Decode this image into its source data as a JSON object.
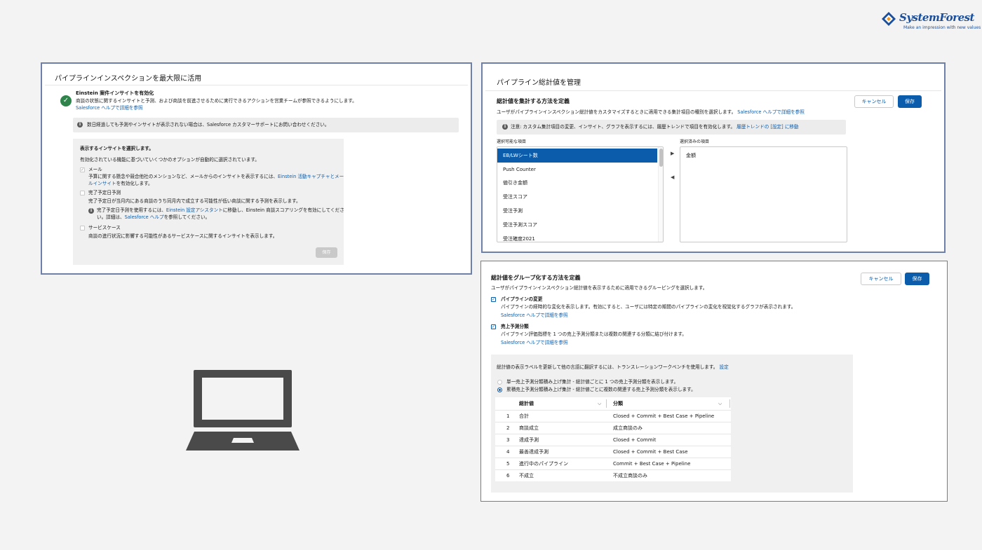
{
  "brand": {
    "name": "SystemForest",
    "tagline": "Make an impression with new values"
  },
  "panel_insights": {
    "title": "パイプラインインスペクションを最大限に活用",
    "einstein_title": "Einstein 案件インサイトを有効化",
    "einstein_desc": "商談の状態に関するインサイトと予測、および商談を前進させるために実行できるアクションを営業チームが参照できるようにします。",
    "help_link": "Salesforce ヘルプで詳細を参照",
    "notice": "数日経過しても予測やインサイトが表示されない場合は、Salesforce カスタマーサポートにお問い合わせください。",
    "select_title": "表示するインサイトを選択します。",
    "select_desc": "有効化されている機能に基づいていくつかのオプションが自動的に選択されています。",
    "options": [
      {
        "label": "メール",
        "desc_a": "予算に関する懸念や競合他社のメンションなど、メールからのインサイトを表示するには、",
        "desc_link_a": "Einstein 活動キャプチャとメー",
        "desc_link_b": "ルインサイト",
        "desc_b": "を有効化します。"
      },
      {
        "label": "完了予定日予測",
        "desc": "完了予定日が当月内にある商談のうち同月内で成立する可能性が低い商談に関する予測を表示します。",
        "note_a": "完了予定日予測を使用するには、",
        "note_link": "Einstein 設定アシスタント",
        "note_b": "に移動し、Einstein 商談スコアリングを有効にしてくださ",
        "note_c": "い。詳細は、",
        "note_link2": "Salesforce ヘルプ",
        "note_d": "を参照してください。"
      },
      {
        "label": "サービスケース",
        "desc": "商談の進行状況に影響する可能性があるサービスケースに関するインサイトを表示します。"
      }
    ],
    "save": "保存"
  },
  "panel_totals": {
    "title": "パイプライン総計値を管理",
    "section_title": "総計値を集計する方法を定義",
    "section_desc": "ユーザがパイプラインインスペクション総計値をカスタマイズするときに適用できる集計項目の種別を選択します。",
    "help_link": "Salesforce ヘルプで詳細を参照",
    "notice": "注意: カスタム集計項目の変更、インサイト、グラフを表示するには、履歴トレンドで項目を有効化します。",
    "notice_link": "履歴トレンドの [設定] に移動",
    "available_label": "選択可能な項目",
    "selected_label": "選択済みの項目",
    "available": [
      "EB/LWシート数",
      "Push Counter",
      "値引き金額",
      "受注スコア",
      "受注予測",
      "受注予測スコア",
      "受注確度2021"
    ],
    "selected": [
      "金額"
    ],
    "cancel": "キャンセル",
    "save": "保存"
  },
  "panel_grouping": {
    "section_title": "総計値をグループ化する方法を定義",
    "section_desc": "ユーザがパイプラインインスペクション総計値を表示するために適用できるグルーピングを選択します。",
    "options": [
      {
        "label": "パイプラインの変更",
        "desc": "パイプラインの経時的な変化を表示します。有効にすると、ユーザには特定の期間のパイプラインの変化を視覚化するグラフが表示されます。",
        "link": "Salesforce ヘルプで詳細を参照"
      },
      {
        "label": "売上予測分類",
        "desc": "パイプライン評価指標を 1 つの売上予測分類または複数の関連する分類に結び付けます。",
        "link": "Salesforce ヘルプで詳細を参照"
      }
    ],
    "translation_note": "総計値の表示ラベルを更新して他の言語に翻訳するには、トランスレーションワークベンチを使用します。",
    "translation_link": "設定",
    "radios": [
      "単一売上予測分類積み上げ集計 - 総計値ごとに 1 つの売上予測分類を表示します。",
      "累積売上予測分類積み上げ集計 - 総計値ごとに複数の関連する売上予測分類を表示します。"
    ],
    "table": {
      "col_total": "総計値",
      "col_category": "分類",
      "rows": [
        {
          "n": "1",
          "total": "合計",
          "category": "Closed + Commit + Best Case + Pipeline"
        },
        {
          "n": "2",
          "total": "商談成立",
          "category": "成立商談のみ"
        },
        {
          "n": "3",
          "total": "達成予測",
          "category": "Closed + Commit"
        },
        {
          "n": "4",
          "total": "最善達成予測",
          "category": "Closed + Commit + Best Case"
        },
        {
          "n": "5",
          "total": "進行中のパイプライン",
          "category": "Commit + Best Case + Pipeline"
        },
        {
          "n": "6",
          "total": "不成立",
          "category": "不成立商談のみ"
        }
      ]
    },
    "cancel": "キャンセル",
    "save": "保存"
  },
  "colors": {
    "brand": "#0b5cab",
    "success": "#2e844a",
    "logo": "#1b4f9c",
    "laptop": "#4a4a4a"
  },
  "icons": [
    "success-check-icon",
    "info-icon",
    "laptop-icon",
    "chevron-down-icon",
    "move-right-icon",
    "move-left-icon"
  ]
}
